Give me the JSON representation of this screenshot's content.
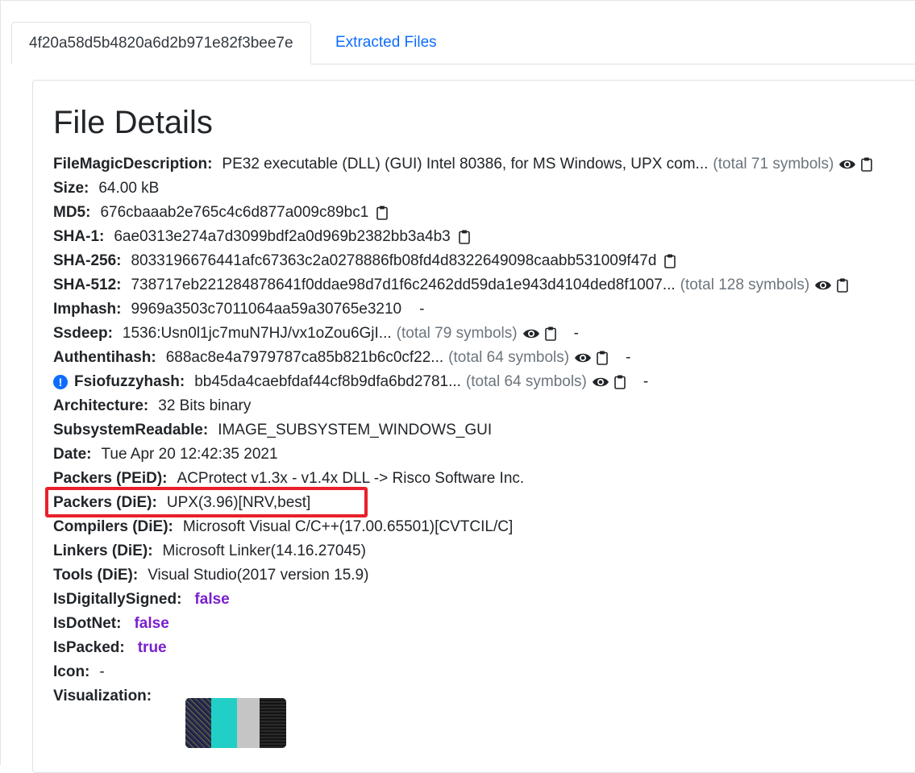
{
  "tabs": [
    {
      "label": "4f20a58d5b4820a6d2b971e82f3bee7e",
      "active": true
    },
    {
      "label": "Extracted Files",
      "active": false
    }
  ],
  "title": "File Details",
  "rows": {
    "filemagic": {
      "key": "FileMagicDescription:",
      "value": "PE32 executable (DLL) (GUI) Intel 80386, for MS Windows, UPX com...",
      "total": "(total 71 symbols)"
    },
    "size": {
      "key": "Size:",
      "value": "64.00 kB"
    },
    "md5": {
      "key": "MD5:",
      "value": "676cbaaab2e765c4c6d877a009c89bc1"
    },
    "sha1": {
      "key": "SHA-1:",
      "value": "6ae0313e274a7d3099bdf2a0d969b2382bb3a4b3"
    },
    "sha256": {
      "key": "SHA-256:",
      "value": "8033196676441afc67363c2a0278886fb08fd4d8322649098caabb531009f47d"
    },
    "sha512": {
      "key": "SHA-512:",
      "value": "738717eb221284878641f0ddae98d7d1f6c2462dd59da1e943d4104ded8f1007...",
      "total": "(total 128 symbols)"
    },
    "imphash": {
      "key": "Imphash:",
      "value": "9969a3503c7011064aa59a30765e3210",
      "dash": "-"
    },
    "ssdeep": {
      "key": "Ssdeep:",
      "value": "1536:Usn0l1jc7muN7HJ/vx1oZou6GjI...",
      "total": "(total 79 symbols)",
      "dash": "-"
    },
    "authentihash": {
      "key": "Authentihash:",
      "value": "688ac8e4a7979787ca85b821b6c0cf22...",
      "total": "(total 64 symbols)",
      "dash": "-"
    },
    "fsiofuzzyhash": {
      "key": "Fsiofuzzyhash:",
      "value": "bb45da4caebfdaf44cf8b9dfa6bd2781...",
      "total": "(total 64 symbols)",
      "dash": "-",
      "info": "!"
    },
    "architecture": {
      "key": "Architecture:",
      "value": "32 Bits binary"
    },
    "subsystem": {
      "key": "SubsystemReadable:",
      "value": "IMAGE_SUBSYSTEM_WINDOWS_GUI"
    },
    "date": {
      "key": "Date:",
      "value": "Tue Apr 20 12:42:35 2021"
    },
    "packers_peid": {
      "key": "Packers (PEiD):",
      "value": "ACProtect v1.3x - v1.4x DLL -> Risco Software Inc."
    },
    "packers_die": {
      "key": "Packers (DiE):",
      "value": "UPX(3.96)[NRV,best]"
    },
    "compilers_die": {
      "key": "Compilers (DiE):",
      "value": "Microsoft Visual C/C++(17.00.65501)[CVTCIL/C]"
    },
    "linkers_die": {
      "key": "Linkers (DiE):",
      "value": "Microsoft Linker(14.16.27045)"
    },
    "tools_die": {
      "key": "Tools (DiE):",
      "value": "Visual Studio(2017 version 15.9)"
    },
    "signed": {
      "key": "IsDigitallySigned:",
      "value": "false"
    },
    "dotnet": {
      "key": "IsDotNet:",
      "value": "false"
    },
    "packed": {
      "key": "IsPacked:",
      "value": "true"
    },
    "icon": {
      "key": "Icon:",
      "value": "-"
    },
    "visualization": {
      "key": "Visualization:"
    }
  },
  "colors": {
    "link": "#0d6efd",
    "boolean": "#7a1fcf",
    "highlight": "#e8202a",
    "muted": "#6c757d"
  },
  "icons": {
    "view": "eye-icon",
    "copy": "clipboard-icon",
    "info": "info-icon"
  }
}
